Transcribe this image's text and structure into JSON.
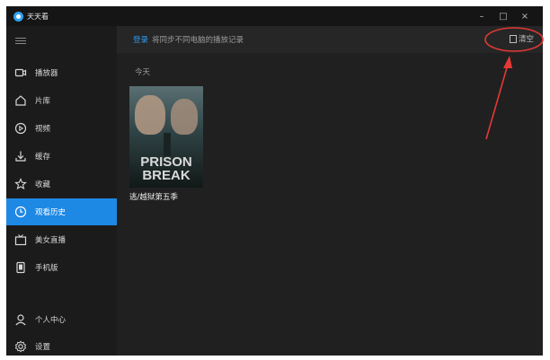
{
  "window": {
    "title": "天天看"
  },
  "window_controls": {
    "minimize": "–",
    "maximize": "□",
    "close": "×"
  },
  "sidebar": {
    "items": [
      {
        "label": "播放器",
        "icon": "video-icon"
      },
      {
        "label": "片库",
        "icon": "home-icon"
      },
      {
        "label": "视频",
        "icon": "play-circle-icon"
      },
      {
        "label": "缓存",
        "icon": "download-icon"
      },
      {
        "label": "收藏",
        "icon": "star-icon"
      },
      {
        "label": "观看历史",
        "icon": "clock-icon",
        "active": true
      },
      {
        "label": "美女直播",
        "icon": "tv-icon"
      },
      {
        "label": "手机版",
        "icon": "phone-icon"
      },
      {
        "label": "个人中心",
        "icon": "user-icon"
      },
      {
        "label": "设置",
        "icon": "settings-icon"
      }
    ]
  },
  "topbar": {
    "login": "登录",
    "hint": "将同步不同电脑的播放记录",
    "clear": "清空"
  },
  "history": {
    "section_label": "今天",
    "items": [
      {
        "title": "逃/越狱第五季",
        "poster_text_1": "PRISON",
        "poster_text_2": "BREAK"
      }
    ]
  },
  "colors": {
    "accent": "#1e88e5",
    "annotation": "#e53935"
  }
}
